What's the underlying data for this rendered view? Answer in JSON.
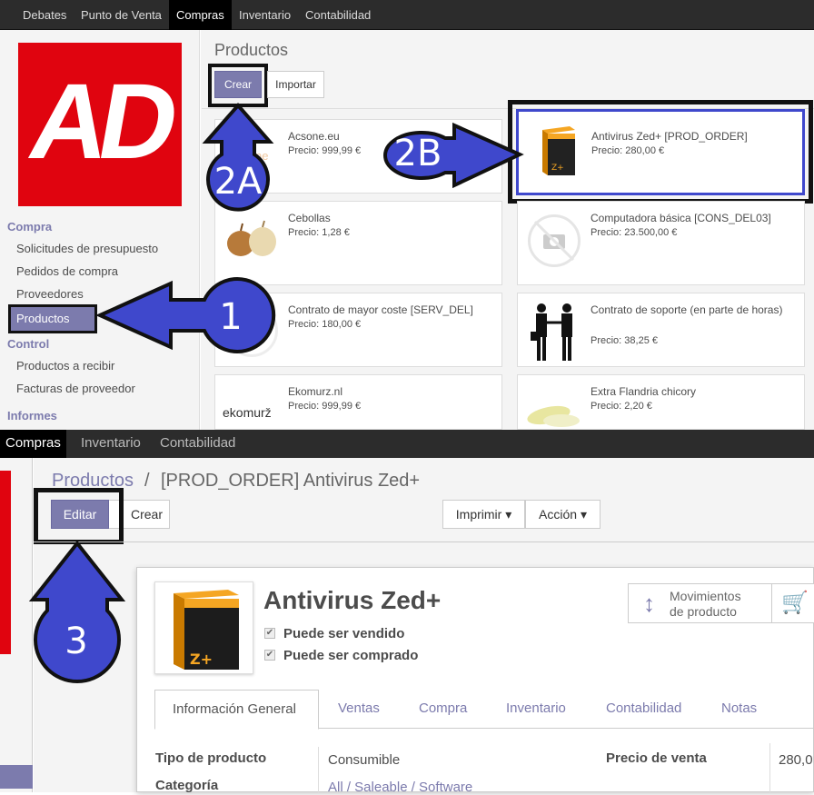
{
  "top": {
    "menu": [
      "Debates",
      "Punto de Venta",
      "Compras",
      "Inventario",
      "Contabilidad"
    ],
    "logo_text": "AD",
    "sidebar": {
      "compra_title": "Compra",
      "compra_items": [
        "Solicitudes de presupuesto",
        "Pedidos de compra",
        "Proveedores",
        "Productos"
      ],
      "control_title": "Control",
      "control_items": [
        "Productos a recibir",
        "Facturas de proveedor"
      ],
      "informes_title": "Informes"
    },
    "page_title": "Productos",
    "create_label": "Crear",
    "import_label": "Importar",
    "products": [
      {
        "name": "Acsone.eu",
        "price": "Precio: 999,99 €"
      },
      {
        "name": "Antivirus Zed+ [PROD_ORDER]",
        "price": "Precio: 280,00 €"
      },
      {
        "name": "Cebollas",
        "price": "Precio: 1,28 €"
      },
      {
        "name": "Computadora básica [CONS_DEL03]",
        "price": "Precio: 23.500,00 €"
      },
      {
        "name": "Contrato de mayor coste [SERV_DEL]",
        "price": "Precio: 180,00 €"
      },
      {
        "name": "Contrato de soporte (en parte de horas)",
        "price": "Precio: 38,25 €"
      },
      {
        "name": "Ekomurz.nl",
        "price": "Precio: 999,99 €"
      },
      {
        "name": "Extra Flandria chicory",
        "price": "Precio: 2,20 €"
      }
    ],
    "acsone_logo_fragment": "ne",
    "ekomurz_logo": "ekomurž"
  },
  "bottom": {
    "menu": [
      "Compras",
      "Inventario",
      "Contabilidad"
    ],
    "breadcrumb_parent": "Productos",
    "breadcrumb_sep": "/",
    "breadcrumb_current": "[PROD_ORDER] Antivirus Zed+",
    "edit_label": "Editar",
    "create_label": "Crear",
    "print_label": "Imprimir",
    "action_label": "Acción",
    "product_name": "Antivirus Zed+",
    "can_be_sold": "Puede ser vendido",
    "can_be_purchased": "Puede ser comprado",
    "moves_label_1": "Movimientos",
    "moves_label_2": "de producto",
    "tabs": [
      "Información General",
      "Ventas",
      "Compra",
      "Inventario",
      "Contabilidad",
      "Notas"
    ],
    "product_type_label": "Tipo de producto",
    "product_type_value": "Consumible",
    "category_label": "Categoría",
    "category_value": "All / Saleable / Software",
    "sale_price_label": "Precio de venta",
    "sale_price_value": "280,0"
  },
  "annotations": [
    "1",
    "2A",
    "2B",
    "3"
  ],
  "colors": {
    "accent": "#7c7bad",
    "arrow": "#3f48cc",
    "logo_red": "#e0040f",
    "topbar": "#2c2c2c"
  }
}
